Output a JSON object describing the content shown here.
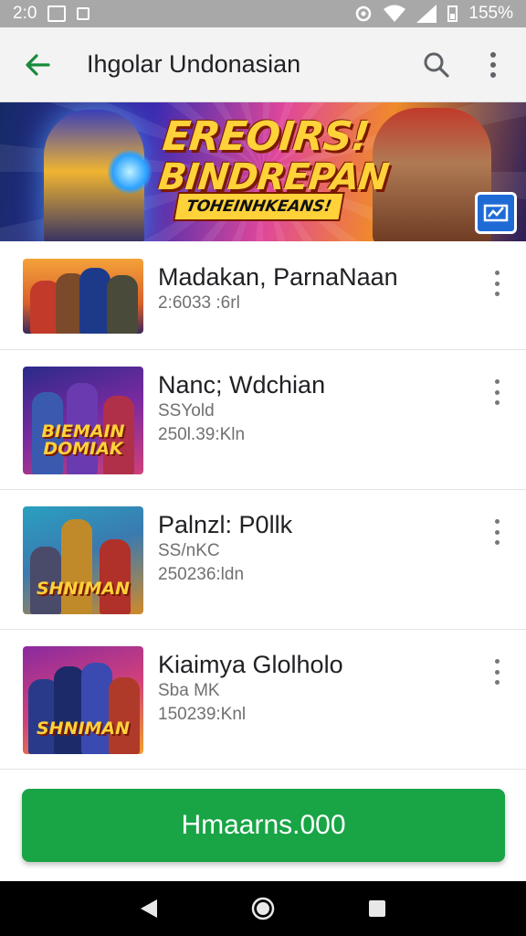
{
  "status_bar": {
    "time": "2:0",
    "battery": "155%",
    "icons": [
      "image-icon",
      "notification-icon",
      "sync-icon",
      "wifi-icon",
      "signal-icon",
      "battery-icon"
    ]
  },
  "app_bar": {
    "title": "Ihgolar Undonasian",
    "icons": [
      "back-arrow-icon",
      "search-icon",
      "more-vert-icon"
    ]
  },
  "banner": {
    "title_line1": "EREOIRS!",
    "title_line2": "BINDREPAN",
    "subtitle": "TOHEINHKEANS!",
    "colors": {
      "accent": "#ffd23a",
      "outline": "#7a1a00"
    }
  },
  "games": [
    {
      "title": "Madakan, ParnaNaan",
      "lines": [
        "2:6033 :6rl"
      ],
      "thumb_text": ""
    },
    {
      "title": "Nanc; Wdchian",
      "lines": [
        "SSYold",
        "250l.39:Kln"
      ],
      "thumb_text": "BIEMAIN DOMIAK"
    },
    {
      "title": "Palnzl: P0llk",
      "lines": [
        "SS/nKC",
        "250236:ldn"
      ],
      "thumb_text": "SHNIMAN"
    },
    {
      "title": "Kiaimya Glolholo",
      "lines": [
        "Sba MK",
        "150239:Knl"
      ],
      "thumb_text": "SHNIMAN"
    }
  ],
  "primary_button": {
    "label": "Hmaarns.000",
    "color": "#19a446"
  },
  "nav_bar": {
    "icons": [
      "back-triangle-icon",
      "home-circle-icon",
      "recents-square-icon"
    ]
  }
}
